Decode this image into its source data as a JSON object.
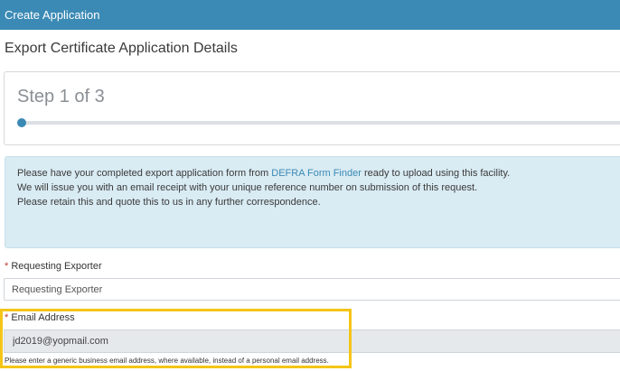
{
  "header": {
    "title": "Create Application"
  },
  "section": {
    "title": "Export Certificate Application Details"
  },
  "step": {
    "label": "Step 1 of 3",
    "current": 1,
    "total": 3
  },
  "info": {
    "line1_before": "Please have your completed export application form from ",
    "line1_link": "DEFRA Form Finder",
    "line1_after": " ready to upload using this facility.",
    "line2": "We will issue you with an email receipt with your unique reference number on submission of this request.",
    "line3": "Please retain this and quote this to us in any further correspondence."
  },
  "fields": {
    "required_marker": "*",
    "exporter": {
      "label": "Requesting Exporter",
      "placeholder": "Requesting Exporter",
      "value": ""
    },
    "email": {
      "label": "Email Address",
      "value": "jd2019@yopmail.com",
      "help": "Please enter a generic business email address, where available, instead of a personal email address."
    }
  },
  "colors": {
    "header_bg": "#3b8ab5",
    "info_bg": "#d9ebf3",
    "highlight": "#f5c518",
    "required": "#c0392b"
  }
}
